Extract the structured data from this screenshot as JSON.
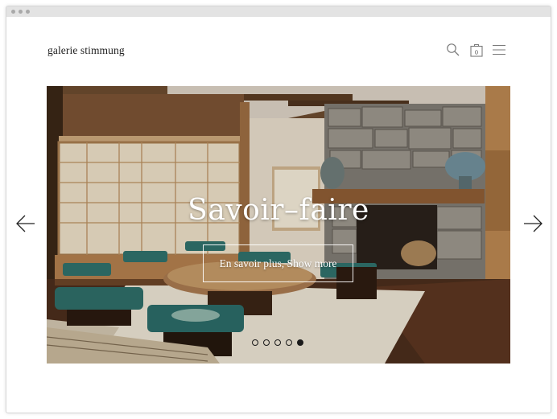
{
  "site": {
    "logo": "galerie stimmung"
  },
  "header": {
    "search_icon": "search-icon",
    "bag_icon": "shopping-bag-icon",
    "bag_count": "0",
    "menu_icon": "hamburger-menu-icon"
  },
  "hero": {
    "title": "Savoir–faire",
    "button_label": "En savoir plus, Show more",
    "slides_total": 5,
    "active_slide": 5
  },
  "nav": {
    "prev_icon": "arrow-left-icon",
    "next_icon": "arrow-right-icon"
  }
}
